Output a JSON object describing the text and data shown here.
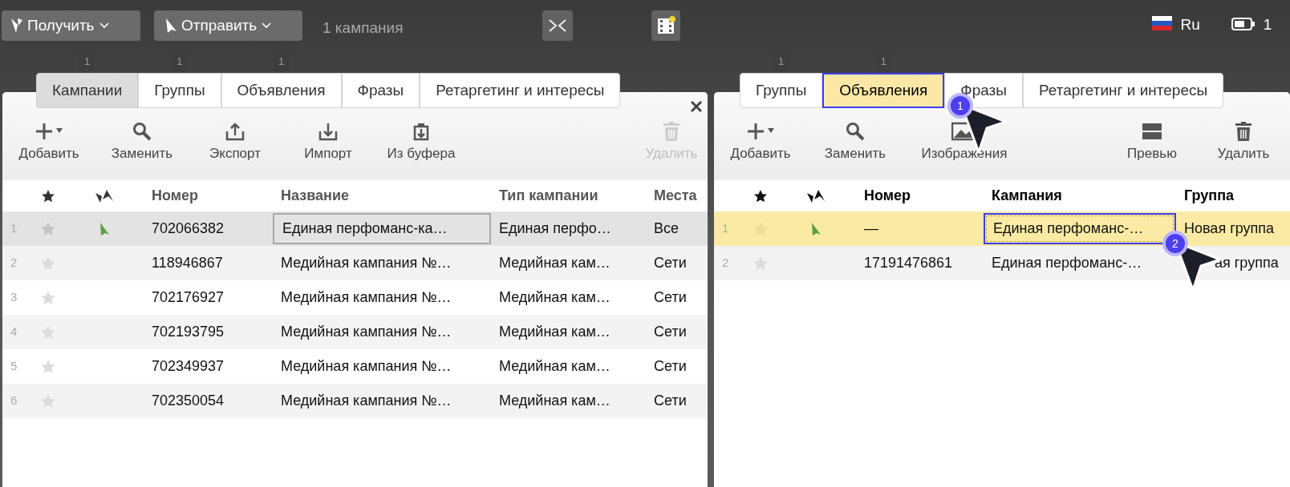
{
  "top_bar": {
    "receive_button": {
      "label": "Получить"
    },
    "send_button": {
      "label": "Отправить"
    },
    "campaign_count": "1 кампания",
    "language": "Ru",
    "clock": "1"
  },
  "panels": [
    {
      "active": false,
      "closable": true,
      "tabs": [
        {
          "label": "Кампании",
          "badge": "1",
          "selected": true
        },
        {
          "label": "Группы",
          "badge": "1",
          "selected": false
        },
        {
          "label": "Объявления",
          "badge": "1",
          "selected": false
        },
        {
          "label": "Фразы",
          "selected": false
        },
        {
          "label": "Ретаргетинг и интересы",
          "selected": false
        }
      ],
      "actions": [
        {
          "kind": "add",
          "label": "Добавить",
          "disabled": false
        },
        {
          "kind": "search",
          "label": "Заменить",
          "disabled": false
        },
        {
          "kind": "export",
          "label": "Экспорт",
          "disabled": false
        },
        {
          "kind": "import",
          "label": "Импорт",
          "disabled": false
        },
        {
          "kind": "clipboard",
          "label": "Из буфера",
          "disabled": false
        },
        {
          "kind": "delete",
          "label": "Удалить",
          "disabled": true
        }
      ],
      "columns": [
        "Номер",
        "Название",
        "Тип кампании",
        "Места"
      ],
      "rows": [
        {
          "index": "1",
          "starred": false,
          "sent": true,
          "selected": true,
          "cells": [
            {
              "text": "702066382",
              "focused": false
            },
            {
              "text": "Единая перфоманс-ка…",
              "focused": true
            },
            {
              "text": "Единая перфо…",
              "focused": false
            },
            {
              "text": "Все",
              "focused": false
            }
          ]
        },
        {
          "index": "2",
          "starred": false,
          "sent": false,
          "selected": false,
          "cells": [
            {
              "text": "118946867",
              "focused": false
            },
            {
              "text": "Медийная кампания №…",
              "focused": false
            },
            {
              "text": "Медийная кам…",
              "focused": false
            },
            {
              "text": "Сети",
              "focused": false
            }
          ]
        },
        {
          "index": "3",
          "starred": false,
          "sent": false,
          "selected": false,
          "cells": [
            {
              "text": "702176927",
              "focused": false
            },
            {
              "text": "Медийная кампания №…",
              "focused": false
            },
            {
              "text": "Медийная кам…",
              "focused": false
            },
            {
              "text": "Сети",
              "focused": false
            }
          ]
        },
        {
          "index": "4",
          "starred": false,
          "sent": false,
          "selected": false,
          "cells": [
            {
              "text": "702193795",
              "focused": false
            },
            {
              "text": "Медийная кампания №…",
              "focused": false
            },
            {
              "text": "Медийная кам…",
              "focused": false
            },
            {
              "text": "Сети",
              "focused": false
            }
          ]
        },
        {
          "index": "5",
          "starred": false,
          "sent": false,
          "selected": false,
          "cells": [
            {
              "text": "702349937",
              "focused": false
            },
            {
              "text": "Медийная кампания №…",
              "focused": false
            },
            {
              "text": "Медийная кам…",
              "focused": false
            },
            {
              "text": "Сети",
              "focused": false
            }
          ]
        },
        {
          "index": "6",
          "starred": false,
          "sent": false,
          "selected": false,
          "cells": [
            {
              "text": "702350054",
              "focused": false
            },
            {
              "text": "Медийная кампания №…",
              "focused": false
            },
            {
              "text": "Медийная кам…",
              "focused": false
            },
            {
              "text": "Сети",
              "focused": false
            }
          ]
        }
      ]
    },
    {
      "active": true,
      "closable": false,
      "tabs": [
        {
          "label": "Группы",
          "badge": "1",
          "selected": false
        },
        {
          "label": "Объявления",
          "badge": "1",
          "selected": true
        },
        {
          "label": "Фразы",
          "selected": false
        },
        {
          "label": "Ретаргетинг и интересы",
          "selected": false
        }
      ],
      "actions": [
        {
          "kind": "add",
          "label": "Добавить",
          "disabled": false
        },
        {
          "kind": "search",
          "label": "Заменить",
          "disabled": false
        },
        {
          "kind": "images",
          "label": "Изображения",
          "disabled": false
        },
        {
          "kind": "preview",
          "label": "Превью",
          "disabled": false
        },
        {
          "kind": "delete",
          "label": "Удалить",
          "disabled": false
        }
      ],
      "columns": [
        "Номер",
        "Кампания",
        "Группа"
      ],
      "rows": [
        {
          "index": "1",
          "starred": false,
          "sent": true,
          "selected": true,
          "cells": [
            {
              "text": "—",
              "focused": false
            },
            {
              "text": "Единая перфоманс-…",
              "focused": true
            },
            {
              "text": "Новая группа",
              "focused": false
            }
          ]
        },
        {
          "index": "2",
          "starred": false,
          "sent": false,
          "selected": false,
          "cells": [
            {
              "text": "17191476861",
              "focused": false
            },
            {
              "text": "Единая перфоманс-…",
              "focused": false
            },
            {
              "text": "ая группа",
              "focused": false
            }
          ]
        }
      ]
    }
  ],
  "cursors": [
    {
      "label": "1"
    },
    {
      "label": "2"
    }
  ]
}
